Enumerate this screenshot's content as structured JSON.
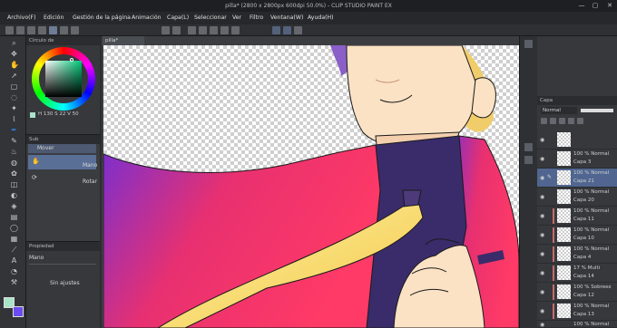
{
  "window": {
    "title": "pilla* (2800 x 2800px 600dpi 50.0%) - CLIP STUDIO PAINT EX",
    "minimize": "—",
    "maximize": "▢",
    "close": "✕"
  },
  "menu": [
    "Archivo(F)",
    "Edición",
    "Gestión de la página",
    "Animación",
    "Capa(L)",
    "Seleccionar",
    "Ver",
    "Filtro",
    "Ventana(W)",
    "Ayuda(H)"
  ],
  "tools": [
    "zoom-icon",
    "move-icon",
    "hand-icon",
    "operation-icon",
    "selection-icon",
    "lasso-icon",
    "wand-icon",
    "eyedropper-icon",
    "pen-icon",
    "pencil-icon",
    "brush-icon",
    "airbrush-icon",
    "decoration-icon",
    "eraser-icon",
    "blend-icon",
    "fill-icon",
    "gradient-icon",
    "figure-icon",
    "frame-icon",
    "ruler-icon",
    "text-icon",
    "balloon-icon",
    "correction-icon"
  ],
  "color_panel": {
    "tab": "Círculo de",
    "readout": "H 130  S 22  V 50",
    "main_color": "#a9e4c8",
    "sub_color": "#6a4cf0"
  },
  "doc_tab": "pilla*",
  "subtool": {
    "header": "Sub",
    "group": "Mover",
    "items": [
      "Mano",
      "Rotar"
    ]
  },
  "toolprop": {
    "header": "Propiedad",
    "tool_name": "Mano",
    "no_settings": "Sin ajustes"
  },
  "layer_panel": {
    "tab": "Capa",
    "blend_mode": "Normal",
    "layers": [
      {
        "mode": "",
        "name": "",
        "clip": ""
      },
      {
        "mode": "100 % Normal",
        "name": "Capa 3",
        "clip": ""
      },
      {
        "mode": "100 % Normal",
        "name": "Capa 21",
        "clip": "",
        "selected": true
      },
      {
        "mode": "100 % Normal",
        "name": "Capa 20",
        "clip": ""
      },
      {
        "mode": "100 % Normal",
        "name": "Capa 11",
        "clip": "#c46b6b"
      },
      {
        "mode": "100 % Normal",
        "name": "Capa 10",
        "clip": "#c46b6b"
      },
      {
        "mode": "100 % Normal",
        "name": "Capa 4",
        "clip": "#c46b6b"
      },
      {
        "mode": "17 % Multi",
        "name": "Capa 14",
        "clip": "#c46b6b"
      },
      {
        "mode": "100 % Sobreex",
        "name": "Capa 12",
        "clip": "#c46b6b"
      },
      {
        "mode": "100 % Normal",
        "name": "Capa 13",
        "clip": "#c46b6b"
      },
      {
        "mode": "100 % Normal",
        "name": "",
        "clip": "#c46b6b"
      }
    ]
  }
}
